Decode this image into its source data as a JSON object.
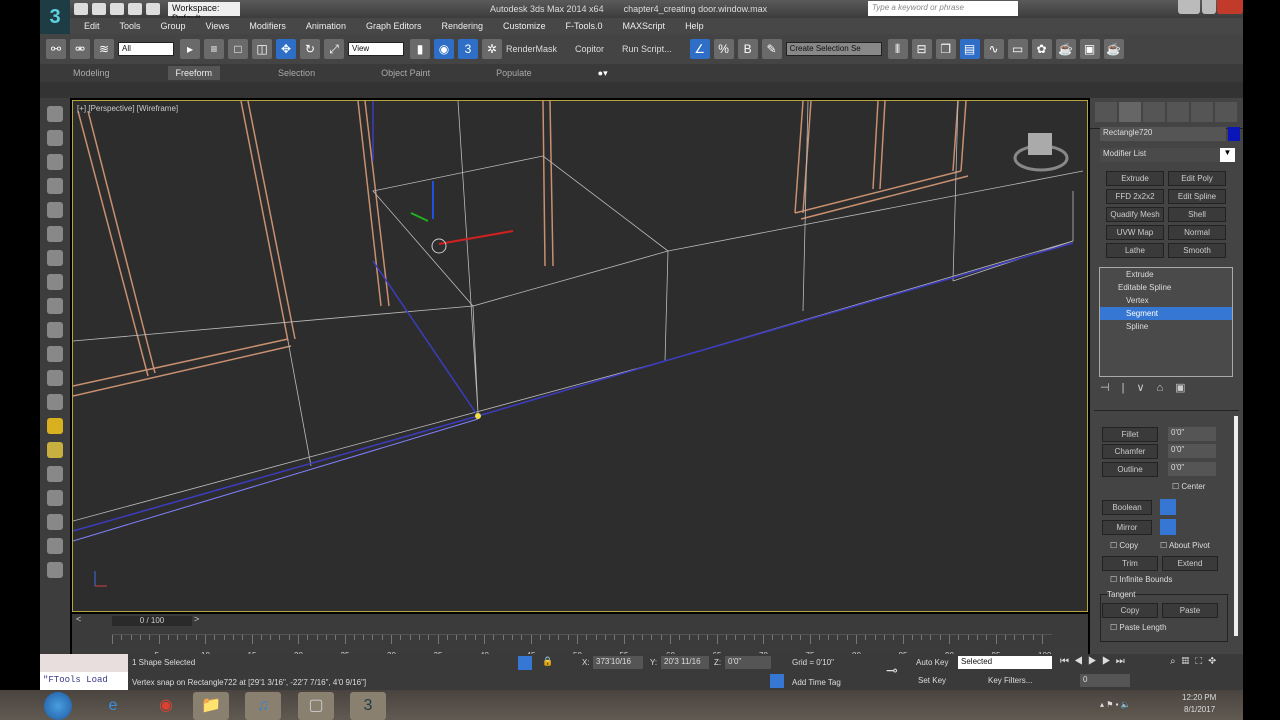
{
  "title_bar": {
    "workspace": "Workspace: Default",
    "app_title": "Autodesk 3ds Max 2014 x64",
    "document": "chapter4_creating door.window.max",
    "search_placeholder": "Type a keyword or phrase"
  },
  "menu": [
    "Edit",
    "Tools",
    "Group",
    "Views",
    "Modifiers",
    "Animation",
    "Graph Editors",
    "Rendering",
    "Customize",
    "F-Tools.0",
    "MAXScript",
    "Help"
  ],
  "toolbar": {
    "selection_filter": "All",
    "ref_coord": "View",
    "render_mask": "RenderMask",
    "copitor": "Copitor",
    "run_script": "Run Script...",
    "named_selection": "Create Selection Se"
  },
  "ribbon_tabs": [
    {
      "label": "Modeling",
      "active": false
    },
    {
      "label": "Freeform",
      "active": true
    },
    {
      "label": "Selection",
      "active": false
    },
    {
      "label": "Object Paint",
      "active": false
    },
    {
      "label": "Populate",
      "active": false
    }
  ],
  "viewport": {
    "label": "[+] [Perspective] [Wireframe]"
  },
  "command_panel": {
    "object_name": "Rectangle720",
    "object_color": "#0a16b8",
    "modifier_list": "Modifier List",
    "modifier_buttons": [
      "Extrude",
      "Edit Poly",
      "FFD 2x2x2",
      "Edit Spline",
      "Quadify Mesh",
      "Shell",
      "UVW Map",
      "Normal",
      "Lathe",
      "Smooth"
    ],
    "stack": [
      {
        "label": "Extrude",
        "selected": false
      },
      {
        "label": "Editable Spline",
        "selected": false
      },
      {
        "label": "Vertex",
        "selected": false
      },
      {
        "label": "Segment",
        "selected": true
      },
      {
        "label": "Spline",
        "selected": false
      }
    ],
    "geometry": {
      "fillet": "Fillet",
      "fillet_val": "0'0\"",
      "chamfer": "Chamfer",
      "chamfer_val": "0'0\"",
      "outline": "Outline",
      "outline_val": "0'0\"",
      "center": "Center",
      "boolean": "Boolean",
      "mirror": "Mirror",
      "copy": "Copy",
      "about_pivot": "About Pivot",
      "trim": "Trim",
      "extend": "Extend",
      "infinite_bounds": "Infinite Bounds",
      "tangent": "Tangent",
      "tangent_copy": "Copy",
      "tangent_paste": "Paste",
      "paste_length": "Paste Length"
    }
  },
  "timeline": {
    "frame": "0 / 100",
    "ticks": [
      "5",
      "10",
      "15",
      "20",
      "25",
      "30",
      "35",
      "40",
      "45",
      "50",
      "55",
      "60",
      "65",
      "70",
      "75",
      "80",
      "85",
      "90",
      "95",
      "100"
    ]
  },
  "status": {
    "maxscript": "\"FTools Load",
    "selection": "1 Shape Selected",
    "prompt": "Vertex snap on Rectangle722 at [29'1 3/16\", -22'7 7/16\", 4'0 9/16\"]",
    "x": "373'10/16",
    "y": "20'3 11/16",
    "z": "0'0\"",
    "grid": "Grid = 0'10\"",
    "add_time_tag": "Add Time Tag",
    "auto_key": "Auto Key",
    "set_key": "Set Key",
    "key_mode": "Selected",
    "key_filters": "Key Filters...",
    "frame": "0"
  },
  "taskbar": {
    "time": "12:20 PM",
    "date": "8/1/2017"
  }
}
